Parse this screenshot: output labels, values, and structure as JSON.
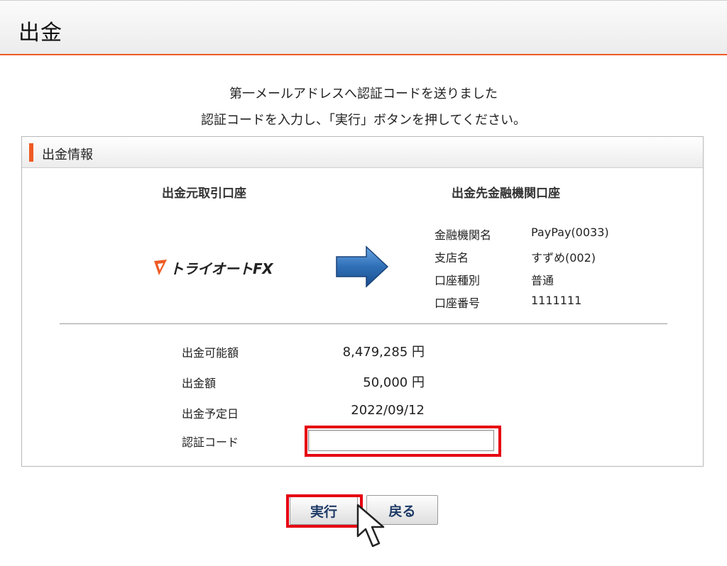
{
  "page": {
    "title": "出金"
  },
  "message": {
    "line1": "第一メールアドレスへ認証コードを送りました",
    "line2": "認証コードを入力し、「実行」ボタンを押してください。"
  },
  "panel": {
    "title": "出金情報",
    "source_heading": "出金元取引口座",
    "destination_heading": "出金先金融機関口座",
    "source_logo_text": "トライオートFX",
    "destination": [
      {
        "label": "金融機関名",
        "value": "PayPay(0033)"
      },
      {
        "label": "支店名",
        "value": "すずめ(002)"
      },
      {
        "label": "口座種別",
        "value": "普通"
      },
      {
        "label": "口座番号",
        "value": "1111111"
      }
    ],
    "info": [
      {
        "label": "出金可能額",
        "value": "8,479,285 円"
      },
      {
        "label": "出金額",
        "value": "50,000 円"
      },
      {
        "label": "出金予定日",
        "value": "2022/09/12"
      }
    ],
    "code_label": "認証コード",
    "code_value": ""
  },
  "buttons": {
    "execute": "実行",
    "back": "戻る"
  },
  "colors": {
    "accent": "#ef5a24",
    "highlight": "#e60012",
    "arrow": "#2f6fb6",
    "button_text": "#1d3a66"
  },
  "icons": {
    "logo_mark": "triangle-logo-icon",
    "transfer": "right-arrow-icon",
    "pointer": "mouse-cursor-icon"
  }
}
